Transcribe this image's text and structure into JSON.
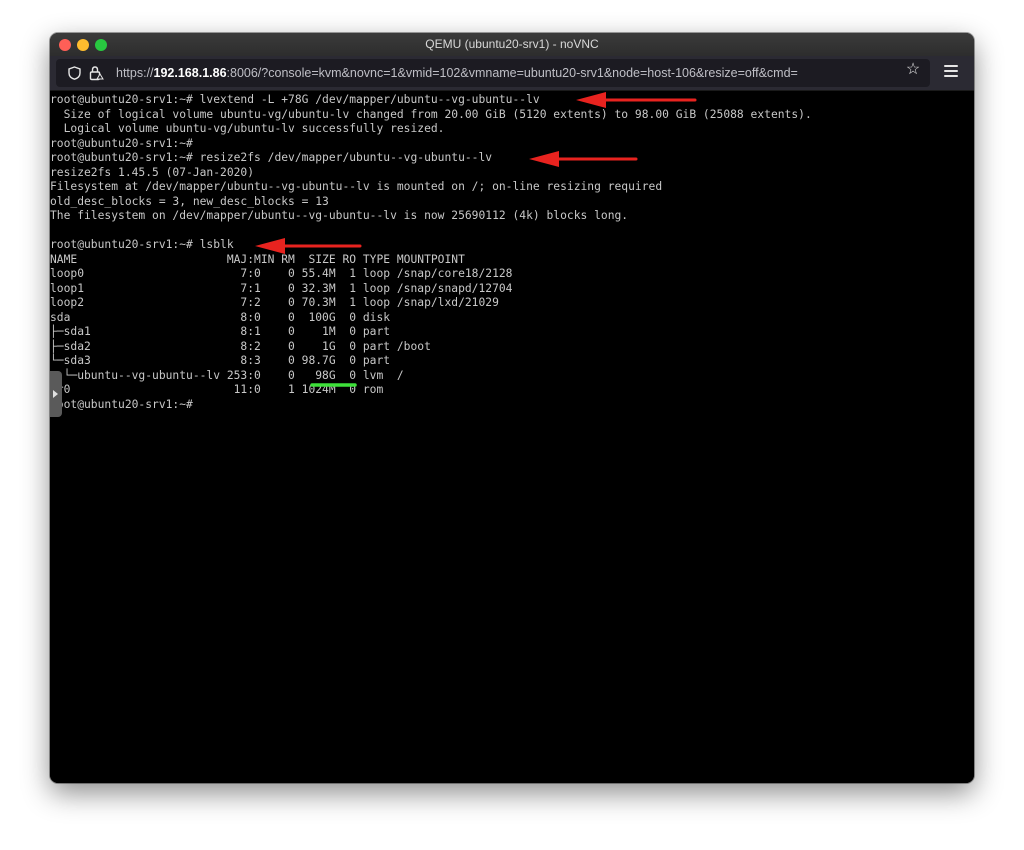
{
  "window": {
    "title": "QEMU (ubuntu20-srv1) - noVNC"
  },
  "browser": {
    "url_prefix": "https://",
    "url_host": "192.168.1.86",
    "url_rest": ":8006/?console=kvm&novnc=1&vmid=102&vmname=ubuntu20-srv1&node=host-106&resize=off&cmd="
  },
  "terminal": {
    "lines": [
      "root@ubuntu20-srv1:~# lvextend -L +78G /dev/mapper/ubuntu--vg-ubuntu--lv",
      "  Size of logical volume ubuntu-vg/ubuntu-lv changed from 20.00 GiB (5120 extents) to 98.00 GiB (25088 extents).",
      "  Logical volume ubuntu-vg/ubuntu-lv successfully resized.",
      "root@ubuntu20-srv1:~#",
      "root@ubuntu20-srv1:~# resize2fs /dev/mapper/ubuntu--vg-ubuntu--lv",
      "resize2fs 1.45.5 (07-Jan-2020)",
      "Filesystem at /dev/mapper/ubuntu--vg-ubuntu--lv is mounted on /; on-line resizing required",
      "old_desc_blocks = 3, new_desc_blocks = 13",
      "The filesystem on /dev/mapper/ubuntu--vg-ubuntu--lv is now 25690112 (4k) blocks long.",
      "",
      "root@ubuntu20-srv1:~# lsblk",
      "NAME                      MAJ:MIN RM  SIZE RO TYPE MOUNTPOINT",
      "loop0                       7:0    0 55.4M  1 loop /snap/core18/2128",
      "loop1                       7:1    0 32.3M  1 loop /snap/snapd/12704",
      "loop2                       7:2    0 70.3M  1 loop /snap/lxd/21029",
      "sda                         8:0    0  100G  0 disk",
      "├─sda1                      8:1    0    1M  0 part",
      "├─sda2                      8:2    0    1G  0 part /boot",
      "└─sda3                      8:3    0 98.7G  0 part",
      "  └─ubuntu--vg-ubuntu--lv 253:0    0   98G  0 lvm  /",
      "sr0                        11:0    1 1024M  0 rom",
      "root@ubuntu20-srv1:~#"
    ]
  },
  "colors": {
    "arrow": "#e8231f",
    "underline": "#3ee03a"
  }
}
